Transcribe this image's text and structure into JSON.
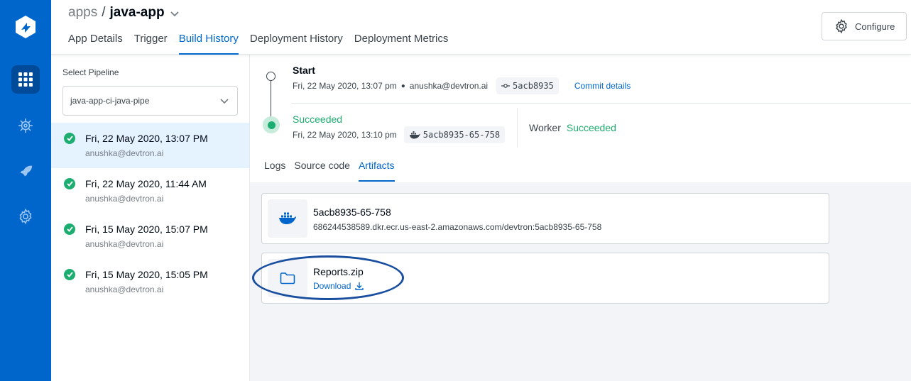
{
  "breadcrumb": {
    "parent": "apps",
    "separator": "/",
    "app": "java-app"
  },
  "tabs": [
    {
      "label": "App Details"
    },
    {
      "label": "Trigger"
    },
    {
      "label": "Build History"
    },
    {
      "label": "Deployment History"
    },
    {
      "label": "Deployment Metrics"
    }
  ],
  "configure_label": "Configure",
  "pipeline": {
    "label": "Select Pipeline",
    "selected": "java-app-ci-java-pipe"
  },
  "builds": [
    {
      "date": "Fri, 22 May 2020, 13:07 PM",
      "user": "anushka@devtron.ai"
    },
    {
      "date": "Fri, 22 May 2020, 11:44 AM",
      "user": "anushka@devtron.ai"
    },
    {
      "date": "Fri, 15 May 2020, 15:07 PM",
      "user": "anushka@devtron.ai"
    },
    {
      "date": "Fri, 15 May 2020, 15:05 PM",
      "user": "anushka@devtron.ai"
    }
  ],
  "summary": {
    "start_title": "Start",
    "start_time": "Fri, 22 May 2020, 13:07 pm",
    "triggered_by": "anushka@devtron.ai",
    "commit_hash": "5acb8935",
    "commit_link": "Commit details",
    "status_title": "Succeeded",
    "finished_time": "Fri, 22 May 2020, 13:10 pm",
    "image_tag": "5acb8935-65-758",
    "worker_label": "Worker",
    "worker_status": "Succeeded"
  },
  "subtabs": [
    {
      "label": "Logs"
    },
    {
      "label": "Source code"
    },
    {
      "label": "Artifacts"
    }
  ],
  "artifacts": {
    "image": {
      "name": "5acb8935-65-758",
      "path": "686244538589.dkr.ecr.us-east-2.amazonaws.com/devtron:5acb8935-65-758"
    },
    "report": {
      "name": "Reports.zip",
      "download_label": "Download"
    }
  },
  "colors": {
    "nav": "#0066cc",
    "accent": "#0066cc",
    "success": "#1dad70",
    "highlight": "#1a4fa0"
  }
}
